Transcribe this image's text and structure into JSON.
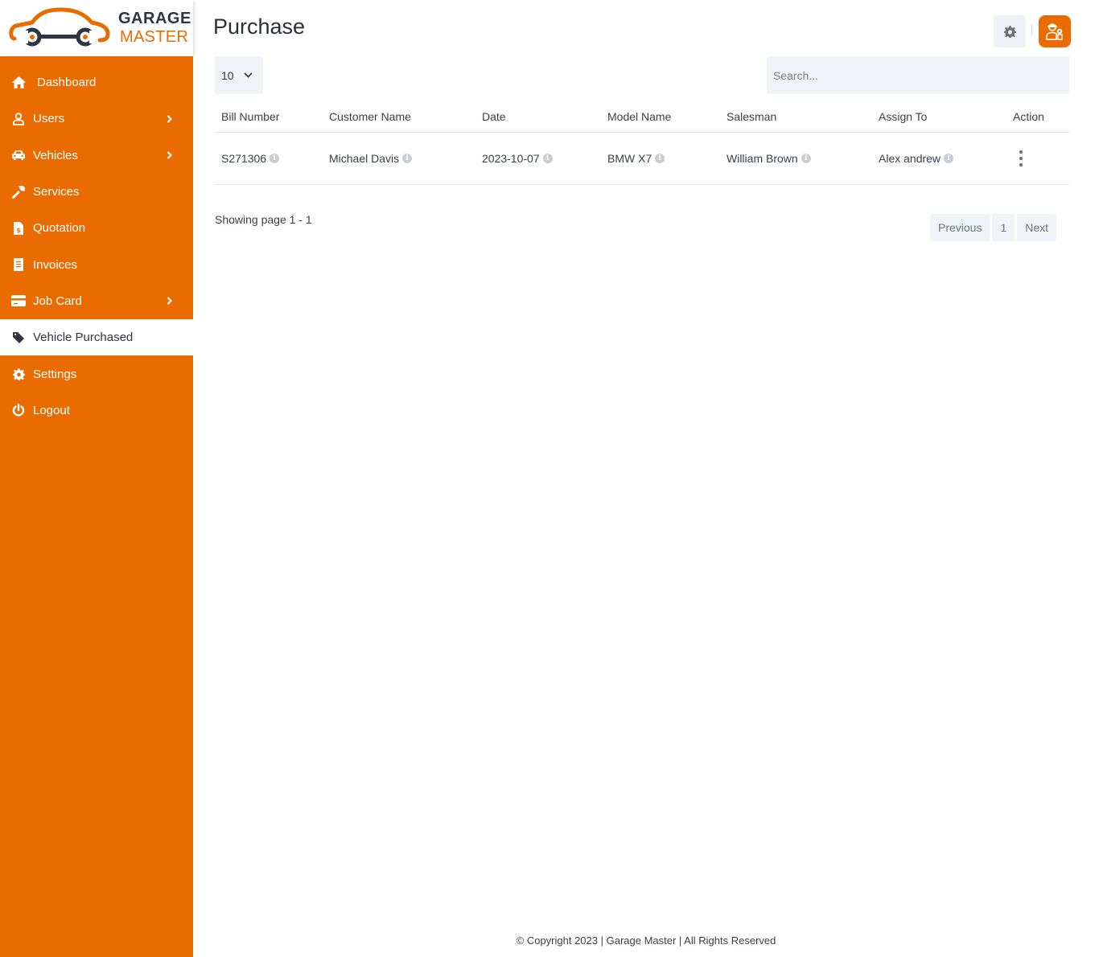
{
  "brand": {
    "line1": "GARAGE",
    "line2": "MASTER",
    "accent_color": "#ea6c00",
    "dark_color": "#2b3544"
  },
  "sidebar": {
    "items": [
      {
        "label": "Dashboard",
        "icon": "home-icon",
        "has_submenu": false,
        "active": false
      },
      {
        "label": "Users",
        "icon": "user-icon",
        "has_submenu": true,
        "active": false
      },
      {
        "label": "Vehicles",
        "icon": "car-icon",
        "has_submenu": true,
        "active": false
      },
      {
        "label": "Services",
        "icon": "wrench-icon",
        "has_submenu": false,
        "active": false
      },
      {
        "label": "Quotation",
        "icon": "file-invoice-dollar-icon",
        "has_submenu": false,
        "active": false
      },
      {
        "label": "Invoices",
        "icon": "receipt-icon",
        "has_submenu": false,
        "active": false
      },
      {
        "label": "Job Card",
        "icon": "credit-card-icon",
        "has_submenu": true,
        "active": false
      },
      {
        "label": "Vehicle Purchased",
        "icon": "tag-icon",
        "has_submenu": false,
        "active": true
      },
      {
        "label": "Settings",
        "icon": "gear-icon",
        "has_submenu": false,
        "active": false
      },
      {
        "label": "Logout",
        "icon": "power-icon",
        "has_submenu": false,
        "active": false
      }
    ]
  },
  "header": {
    "title": "Purchase",
    "settings_icon": "gear-icon",
    "profile_icon": "user-avatar-icon"
  },
  "controls": {
    "page_size": "10",
    "search_placeholder": "Search...",
    "search_value": ""
  },
  "table": {
    "columns": [
      "Bill Number",
      "Customer Name",
      "Date",
      "Model Name",
      "Salesman",
      "Assign To",
      "Action"
    ],
    "rows": [
      {
        "bill_number": "S271306",
        "customer_name": "Michael Davis",
        "date": "2023-10-07",
        "model_name": "BMW X7",
        "salesman": "William Brown",
        "assign_to": "Alex andrew"
      }
    ]
  },
  "pagination": {
    "showing_text": "Showing page 1 - 1",
    "previous_label": "Previous",
    "current_page": "1",
    "next_label": "Next"
  },
  "footer": {
    "copyright": "© Copyright 2023 | Garage Master | All Rights Reserved"
  }
}
